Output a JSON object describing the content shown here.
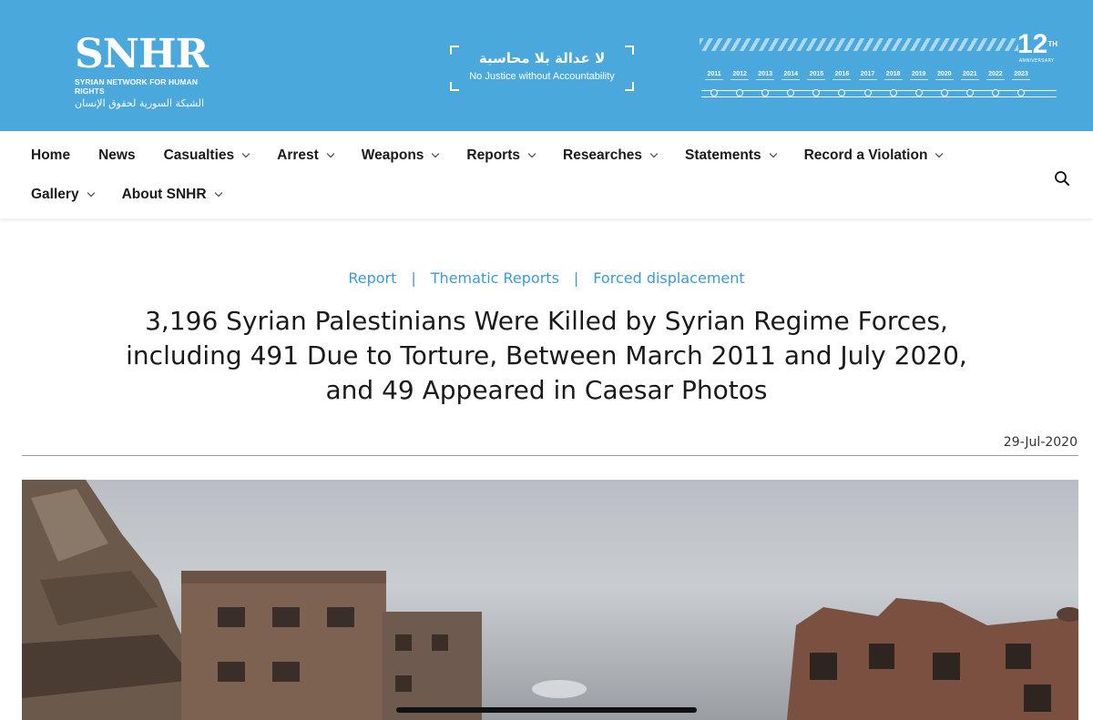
{
  "header": {
    "logo": {
      "word": "SNHR",
      "subtitle": "SYRIAN NETWORK FOR HUMAN RIGHTS",
      "subtitle_ar": "الشبكة السورية لحقوق الإنسان"
    },
    "motto": {
      "arabic": "لا عدالة بلا محاسبة",
      "english": "No Justice without Accountability"
    },
    "anniversary": {
      "number": "12",
      "suffix": "TH",
      "label": "ANNIVERSARY"
    },
    "timeline_years": [
      "2011",
      "2012",
      "2013",
      "2014",
      "2015",
      "2016",
      "2017",
      "2018",
      "2019",
      "2020",
      "2021",
      "2022",
      "2023"
    ]
  },
  "nav": {
    "row1": [
      {
        "label": "Home",
        "dropdown": false
      },
      {
        "label": "News",
        "dropdown": false
      },
      {
        "label": "Casualties",
        "dropdown": true
      },
      {
        "label": "Arrest",
        "dropdown": true
      },
      {
        "label": "Weapons",
        "dropdown": true
      },
      {
        "label": "Reports",
        "dropdown": true
      },
      {
        "label": "Researches",
        "dropdown": true
      },
      {
        "label": "Statements",
        "dropdown": true
      },
      {
        "label": "Record a Violation",
        "dropdown": true
      }
    ],
    "row2": [
      {
        "label": "Gallery",
        "dropdown": true
      },
      {
        "label": "About SNHR",
        "dropdown": true
      }
    ],
    "search_icon": "search-icon"
  },
  "article": {
    "breadcrumbs": [
      "Report",
      "Thematic Reports",
      "Forced displacement"
    ],
    "separator": "|",
    "title": "3,196 Syrian Palestinians Were Killed by Syrian Regime Forces, including 491 Due to Torture, Between March 2011 and July 2020, and 49 Appeared in Caesar Photos",
    "date": "29-Jul-2020"
  },
  "colors": {
    "header_bg": "#4aa8dc",
    "link": "#3a9bd2"
  }
}
